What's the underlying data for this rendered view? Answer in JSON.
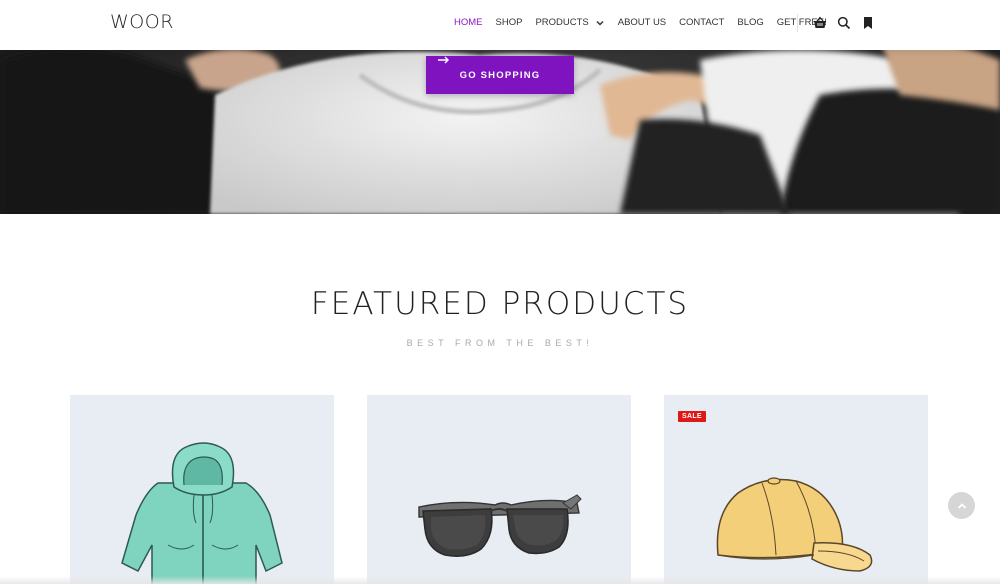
{
  "header": {
    "logo": "WOOR",
    "nav": [
      {
        "label": "HOME",
        "active": true
      },
      {
        "label": "SHOP",
        "active": false
      },
      {
        "label": "PRODUCTS",
        "active": false,
        "dropdown": true
      },
      {
        "label": "ABOUT US",
        "active": false
      },
      {
        "label": "CONTACT",
        "active": false
      },
      {
        "label": "BLOG",
        "active": false
      },
      {
        "label": "GET FREE!",
        "active": false
      }
    ],
    "icons": [
      "basket-icon",
      "search-icon",
      "bookmark-icon"
    ],
    "active_color": "#8a17c4"
  },
  "hero": {
    "button_label": "GO SHOPPING",
    "button_icon": "arrow-right-icon",
    "button_color": "#7f13c0"
  },
  "featured": {
    "title": "FEATURED PRODUCTS",
    "subtitle": "BEST FROM THE BEST!",
    "products": [
      {
        "image": "hoodie-image",
        "badge": ""
      },
      {
        "image": "sunglasses-image",
        "badge": ""
      },
      {
        "image": "cap-image",
        "badge": "SALE"
      }
    ]
  },
  "scroll_top_icon": "chevron-up-icon"
}
